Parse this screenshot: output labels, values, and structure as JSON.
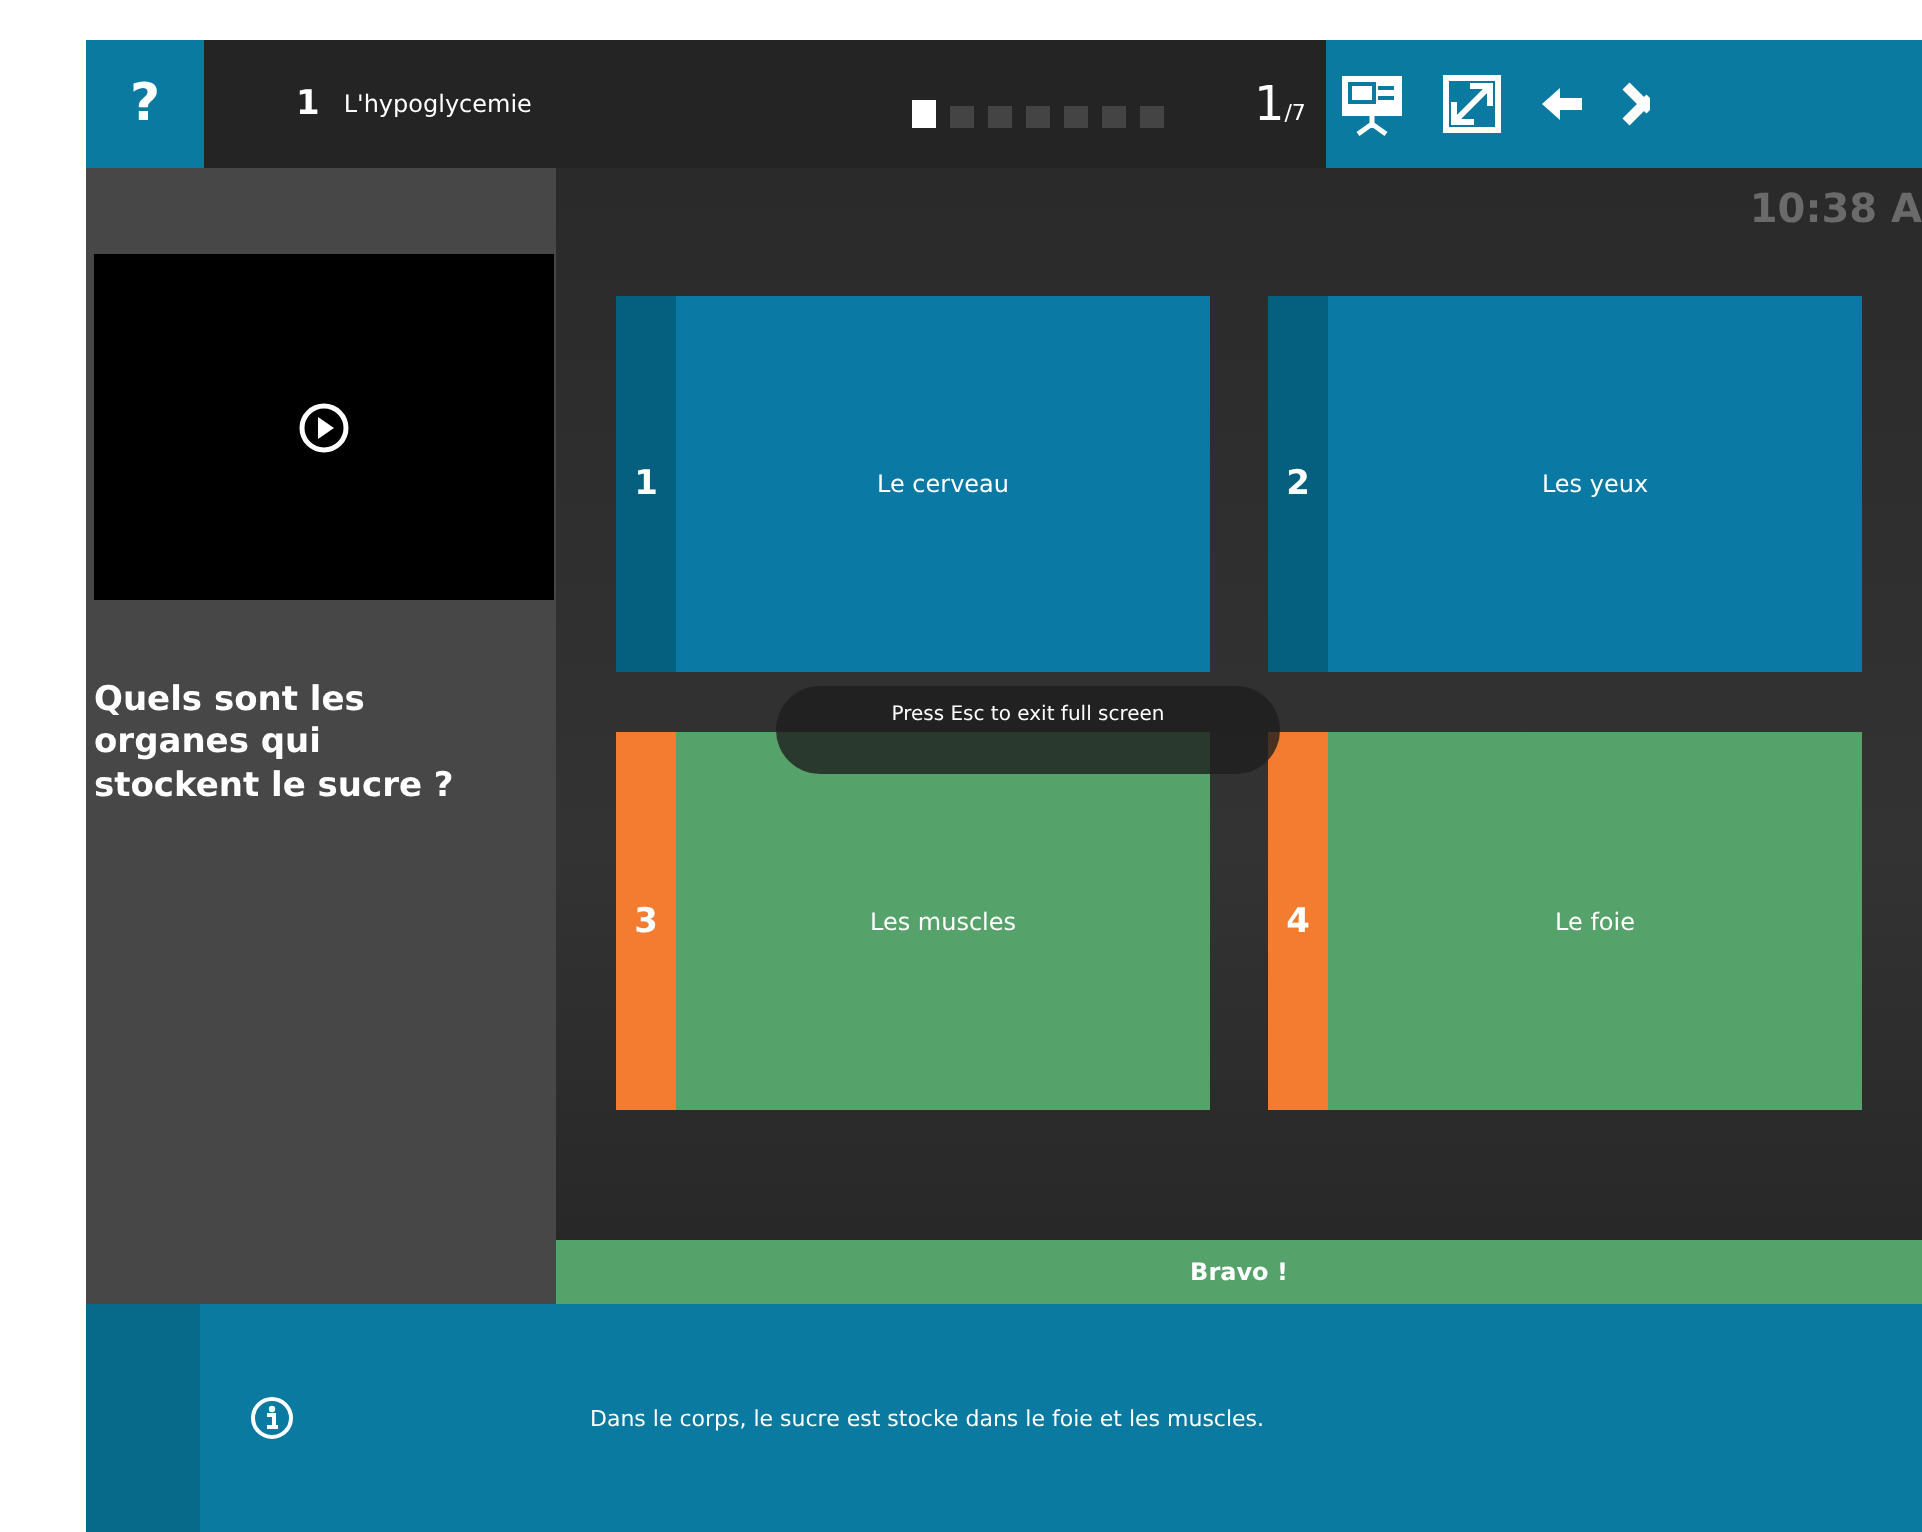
{
  "header": {
    "help": "?",
    "lesson_number": "1",
    "lesson_title": "L'hypoglycemie",
    "progress": [
      {
        "selected": true
      },
      {
        "selected": false
      },
      {
        "selected": false
      },
      {
        "selected": false
      },
      {
        "selected": false
      },
      {
        "selected": false
      },
      {
        "selected": false
      }
    ],
    "page": "1",
    "page_total": "/7",
    "time": "10:38 A"
  },
  "question": "Quels sont les organes qui stockent le sucre ?",
  "answers": [
    {
      "number": "1",
      "label": "Le cerveau",
      "correct": false
    },
    {
      "number": "2",
      "label": "Les yeux",
      "correct": false
    },
    {
      "number": "3",
      "label": "Les muscles",
      "correct": true
    },
    {
      "number": "4",
      "label": "Le foie",
      "correct": true
    }
  ],
  "tooltip": "Press Esc to exit full screen",
  "feedback": "Bravo !",
  "explanation": "Dans le corps, le sucre est stocke dans le foie et les muscles."
}
